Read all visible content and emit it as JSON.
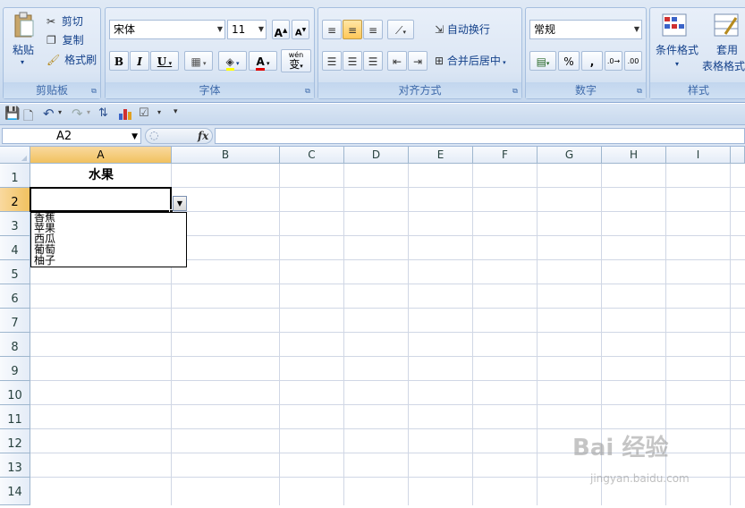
{
  "ribbon": {
    "clipboard": {
      "label": "剪贴板",
      "paste": "粘贴",
      "cut": "剪切",
      "copy": "复制",
      "format_painter": "格式刷"
    },
    "font": {
      "label": "字体",
      "font_name": "宋体",
      "font_size": "11",
      "bold": "B",
      "italic": "I",
      "underline": "U",
      "wen": "wén",
      "wen_char": "变"
    },
    "alignment": {
      "label": "对齐方式",
      "wrap_text": "自动换行",
      "merge_center": "合并后居中"
    },
    "number": {
      "label": "数字",
      "format": "常规",
      "percent": "%",
      "comma": ","
    },
    "styles": {
      "label": "样式",
      "conditional_format": "条件格式",
      "table_format_1": "套用",
      "table_format_2": "表格格式"
    }
  },
  "formula_bar": {
    "name_box": "A2",
    "fx": "fx",
    "content": ""
  },
  "sheet": {
    "columns": [
      "A",
      "B",
      "C",
      "D",
      "E",
      "F",
      "G",
      "H",
      "I"
    ],
    "rows": [
      "1",
      "2",
      "3",
      "4",
      "5",
      "6",
      "7",
      "8",
      "9",
      "10",
      "11",
      "12",
      "13",
      "14"
    ],
    "a1": "水果",
    "selected_cell": "A2",
    "validation_list": [
      "香蕉",
      "苹果",
      "西瓜",
      "葡萄",
      "柚子"
    ]
  },
  "watermark": {
    "brand": "Bai 经验",
    "url": "jingyan.baidu.com"
  }
}
